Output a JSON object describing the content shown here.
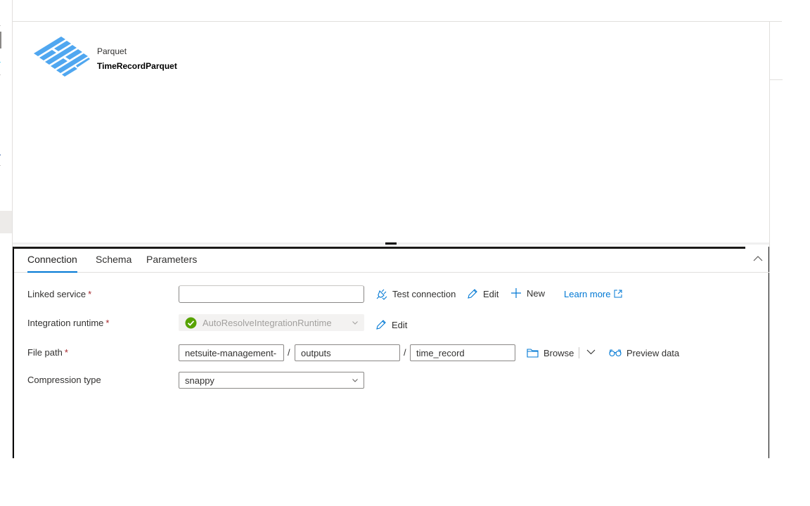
{
  "dataset": {
    "type_label": "Parquet",
    "name": "TimeRecordParquet",
    "icon": "parquet-icon"
  },
  "panel": {
    "tabs": [
      {
        "label": "Connection",
        "active": true
      },
      {
        "label": "Schema",
        "active": false
      },
      {
        "label": "Parameters",
        "active": false
      }
    ],
    "collapse_icon": "chevron-up-icon"
  },
  "form": {
    "linked_service": {
      "label": "Linked service",
      "required_mark": "*",
      "value": "",
      "actions": {
        "test_connection": "Test connection",
        "edit": "Edit",
        "new": "New",
        "learn_more": "Learn more"
      }
    },
    "integration_runtime": {
      "label": "Integration runtime",
      "required_mark": "*",
      "value": "AutoResolveIntegrationRuntime",
      "status_icon": "check-circle-icon",
      "edit": "Edit"
    },
    "file_path": {
      "label": "File path",
      "required_mark": "*",
      "container": "netsuite-management-",
      "directory": "outputs",
      "file": "time_record",
      "separator": "/",
      "browse": "Browse",
      "preview": "Preview data"
    },
    "compression_type": {
      "label": "Compression type",
      "value": "snappy"
    }
  },
  "colors": {
    "accent": "#0078d4",
    "parquet_blue": "#50a7f0",
    "success": "#57a300",
    "required": "#a4262c"
  }
}
